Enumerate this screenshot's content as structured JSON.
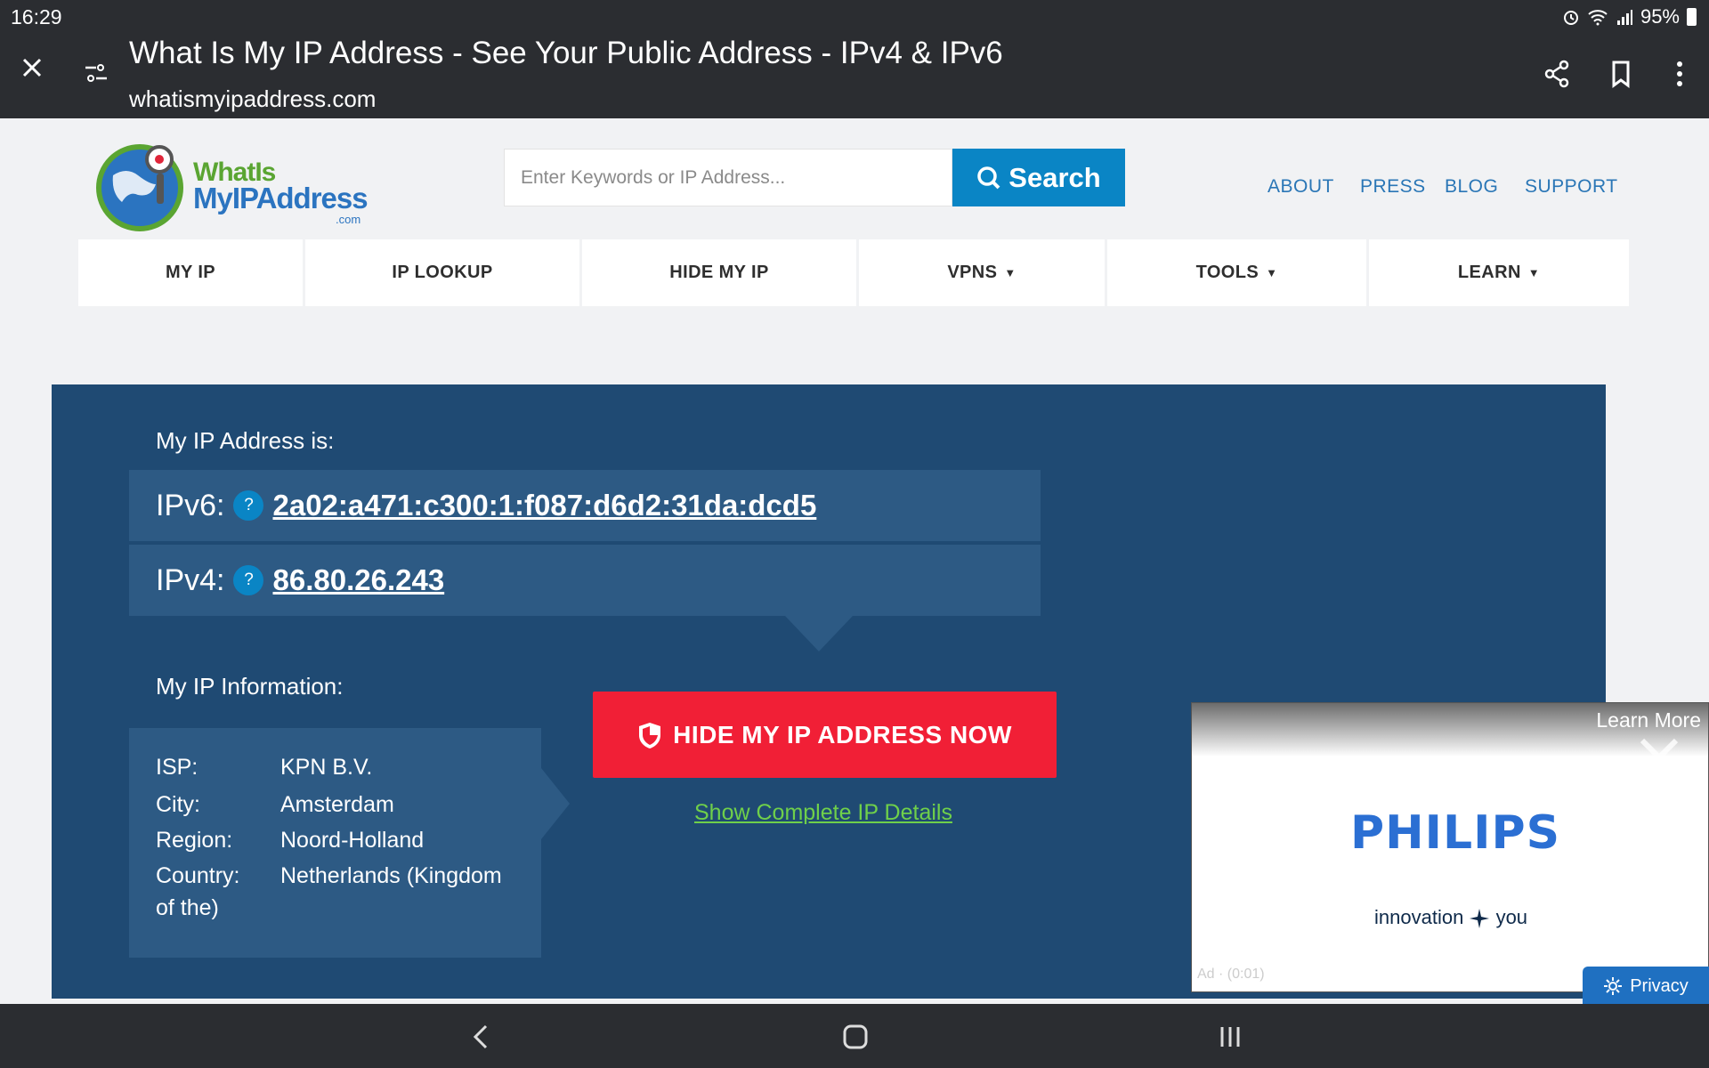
{
  "status": {
    "time": "16:29",
    "battery": "95%"
  },
  "tab": {
    "title": "What Is My IP Address - See Your Public Address - IPv4 & IPv6",
    "url": "whatismyipaddress.com"
  },
  "site": {
    "logo": {
      "line1": "WhatIs",
      "line2": "MyIPAddress",
      "suffix": ".com"
    },
    "search": {
      "placeholder": "Enter Keywords or IP Address...",
      "button": "Search"
    },
    "top_links": [
      "ABOUT",
      "PRESS",
      "BLOG",
      "SUPPORT"
    ],
    "nav": [
      "MY IP",
      "IP LOOKUP",
      "HIDE MY IP",
      "VPNS",
      "TOOLS",
      "LEARN"
    ]
  },
  "main": {
    "ip_heading": "My IP Address is:",
    "ipv6_label": "IPv6:",
    "ipv6_value": "2a02:a471:c300:1:f087:d6d2:31da:dcd5",
    "ipv4_label": "IPv4:",
    "ipv4_value": "86.80.26.243",
    "help_mark": "?",
    "info_heading": "My IP Information:",
    "info": {
      "isp_label": "ISP:",
      "isp": "KPN B.V.",
      "city_label": "City:",
      "city": "Amsterdam",
      "region_label": "Region:",
      "region": "Noord-Holland",
      "country_label": "Country:",
      "country_line1": "Netherlands (Kingdom",
      "country_line2": "of the)"
    },
    "hide_button": "HIDE MY IP ADDRESS NOW",
    "details_link": "Show Complete IP Details"
  },
  "ad": {
    "learn_more": "Learn More",
    "brand": "PHILIPS",
    "tagline_left": "innovation",
    "tagline_right": "you",
    "meta": "Ad · (0:01)",
    "privacy": "Privacy"
  },
  "colors": {
    "panel": "#1f4a73",
    "accent_blue": "#0a85c5",
    "hide_red": "#f11f36",
    "link_green": "#6fd04a"
  }
}
